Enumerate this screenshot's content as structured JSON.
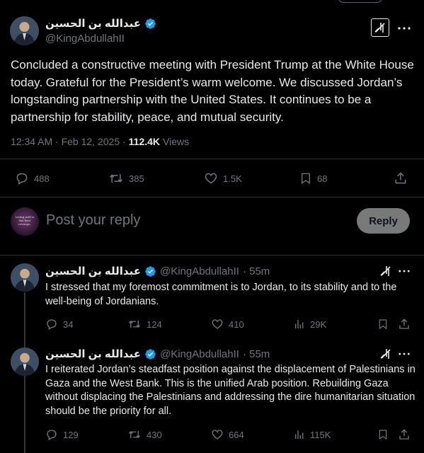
{
  "main_post": {
    "author_name": "عبدالله بن الحسين",
    "handle": "@KingAbdullahII",
    "text": "Concluded a constructive meeting with President Trump at the White House today. Grateful for the President’s warm welcome. We discussed Jordan’s longstanding partnership with the United States. It continues to be a partnership for stability, peace, and mutual security.",
    "time": "12:34 AM · Feb 12, 2025 ·",
    "views_count": "112.4K",
    "views_label": "Views",
    "replies": "488",
    "reposts": "385",
    "likes": "1.5K",
    "bookmarks": "68"
  },
  "reply_box": {
    "avatar_text": "Living well is the best revenge.",
    "placeholder": "Post your reply",
    "button_label": "Reply"
  },
  "thread": [
    {
      "author_name": "عبدالله بن الحسين",
      "handle": "@KingAbdullahII",
      "age": "· 55m",
      "text": "I stressed that my foremost commitment is to Jordan, to its stability and to the well-being of Jordanians.",
      "replies": "34",
      "reposts": "124",
      "likes": "410",
      "views": "29K"
    },
    {
      "author_name": "عبدالله بن الحسين",
      "handle": "@KingAbdullahII",
      "age": "· 55m",
      "text": "I reiterated Jordan’s steadfast position against the displacement of Palestinians in Gaza and the West Bank. This is the unified Arab position. Rebuilding Gaza without displacing the Palestinians and addressing the dire humanitarian situation should be the priority for all.",
      "replies": "129",
      "reposts": "430",
      "likes": "664",
      "views": "115K"
    }
  ],
  "colors": {
    "background": "#000000",
    "text": "#e7e9ea",
    "muted": "#71767b",
    "verified": "#1d9bf0",
    "reply_button": "#787a7a",
    "divider": "#2f3336"
  },
  "icons": [
    "verified-badge",
    "grok-icon",
    "more-icon",
    "reply-icon",
    "repost-icon",
    "like-icon",
    "views-icon",
    "bookmark-icon",
    "share-icon"
  ]
}
